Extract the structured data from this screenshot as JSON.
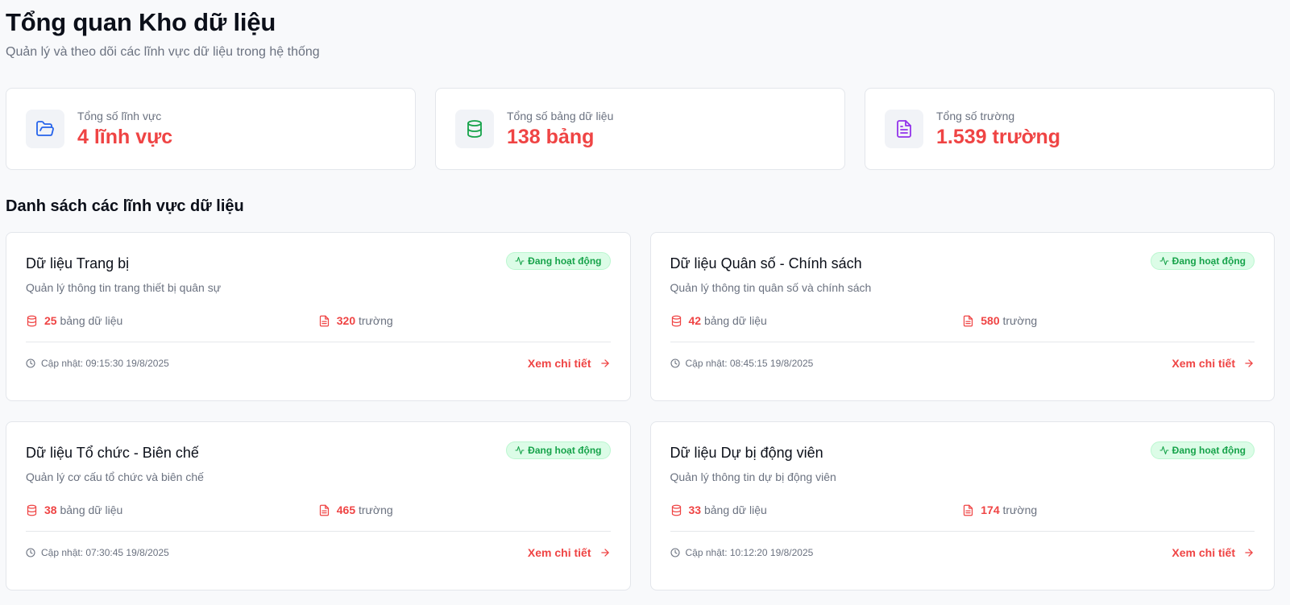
{
  "page": {
    "title": "Tổng quan Kho dữ liệu",
    "subtitle": "Quản lý và theo dõi các lĩnh vực dữ liệu trong hệ thống"
  },
  "stats": [
    {
      "label": "Tổng số lĩnh vực",
      "value": "4 lĩnh vực",
      "icon": "folder-open-icon",
      "color": "#2563eb"
    },
    {
      "label": "Tổng số bảng dữ liệu",
      "value": "138 bảng",
      "icon": "database-icon",
      "color": "#16a34a"
    },
    {
      "label": "Tổng số trường",
      "value": "1.539 trường",
      "icon": "file-text-icon",
      "color": "#9333ea"
    }
  ],
  "section": {
    "title": "Danh sách các lĩnh vực dữ liệu"
  },
  "domains": [
    {
      "title": "Dữ liệu Trang bị",
      "status": "Đang hoạt động",
      "description": "Quản lý thông tin trang thiết bị quân sự",
      "tables_count": "25",
      "tables_label": "bảng dữ liệu",
      "fields_count": "320",
      "fields_label": "trường",
      "updated": "Cập nhật: 09:15:30 19/8/2025",
      "link_label": "Xem chi tiết"
    },
    {
      "title": "Dữ liệu Quân số - Chính sách",
      "status": "Đang hoạt động",
      "description": "Quản lý thông tin quân số và chính sách",
      "tables_count": "42",
      "tables_label": "bảng dữ liệu",
      "fields_count": "580",
      "fields_label": "trường",
      "updated": "Cập nhật: 08:45:15 19/8/2025",
      "link_label": "Xem chi tiết"
    },
    {
      "title": "Dữ liệu Tổ chức - Biên chế",
      "status": "Đang hoạt động",
      "description": "Quản lý cơ cấu tổ chức và biên chế",
      "tables_count": "38",
      "tables_label": "bảng dữ liệu",
      "fields_count": "465",
      "fields_label": "trường",
      "updated": "Cập nhật: 07:30:45 19/8/2025",
      "link_label": "Xem chi tiết"
    },
    {
      "title": "Dữ liệu Dự bị động viên",
      "status": "Đang hoạt động",
      "description": "Quản lý thông tin dự bị động viên",
      "tables_count": "33",
      "tables_label": "bảng dữ liệu",
      "fields_count": "174",
      "fields_label": "trường",
      "updated": "Cập nhật: 10:12:20 19/8/2025",
      "link_label": "Xem chi tiết"
    }
  ],
  "colors": {
    "accent": "#ef4444",
    "status_green": "#16a34a",
    "status_bg": "#dcfce7"
  }
}
